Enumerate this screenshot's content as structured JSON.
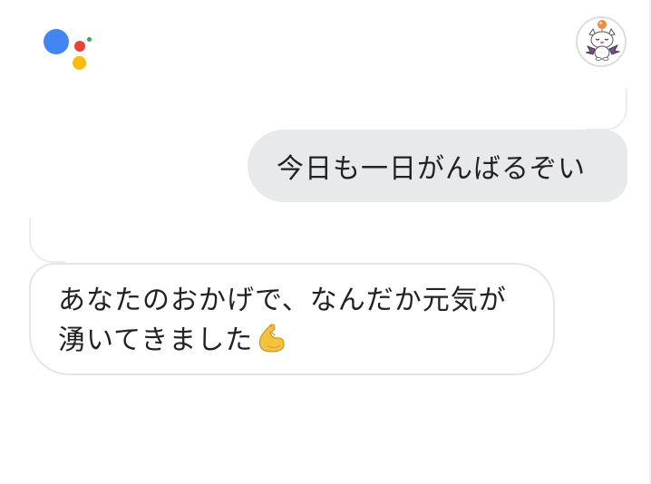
{
  "assistant": {
    "logo_colors": {
      "blue": "#4285F4",
      "red": "#EA4335",
      "yellow": "#FBBC05",
      "green": "#34A853"
    }
  },
  "user": {
    "avatar_icon": "moogle-avatar-icon"
  },
  "conversation": {
    "user_message": "今日も一日がんばるぞい",
    "assistant_reply": {
      "line1": "あなたのおかげで、なんだか元気が",
      "line2": "湧いてきました",
      "emoji": "flexed-biceps-emoji"
    }
  },
  "colors": {
    "user_bubble": "#e8e9eb",
    "assistant_bubble_border": "#e6e6e6",
    "text": "#222222"
  }
}
